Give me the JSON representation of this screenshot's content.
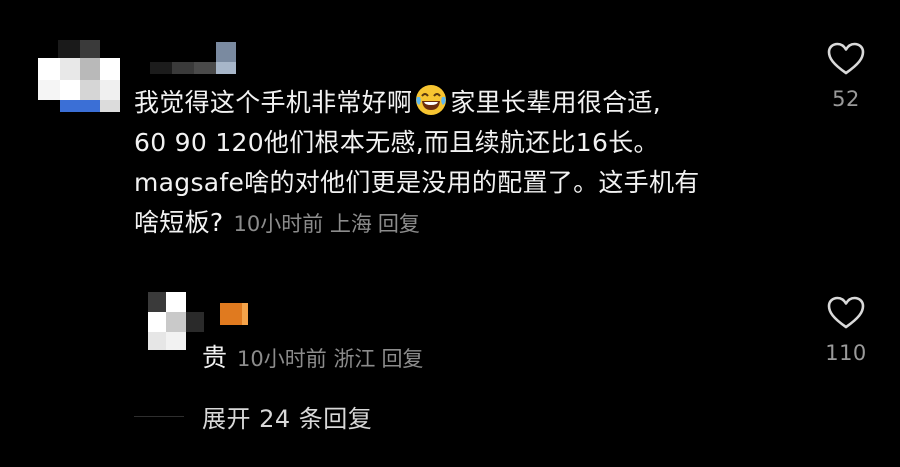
{
  "comment": {
    "lines": [
      "我觉得这个手机非常好啊",
      "家里长辈用很合适,",
      "60 90 120他们根本无感,而且续航还比16长。",
      "magsafe啥的对他们更是没用的配置了。这手机有",
      "啥短板?"
    ],
    "time": "10小时前",
    "location": "上海",
    "reply_label": "回复",
    "like_count": "52",
    "emoji_icon": "laughing-tears-emoji-icon"
  },
  "sub_reply": {
    "text": "贵",
    "time": "10小时前",
    "location": "浙江",
    "reply_label": "回复",
    "like_count": "110"
  },
  "expand": {
    "label": "展开 24 条回复"
  },
  "colors": {
    "background": "#000000",
    "text": "#f2f2f2",
    "meta": "#8c8c8c",
    "avatar_blue": "#3b6fd6",
    "avatar_orange": "#e07a1f"
  }
}
